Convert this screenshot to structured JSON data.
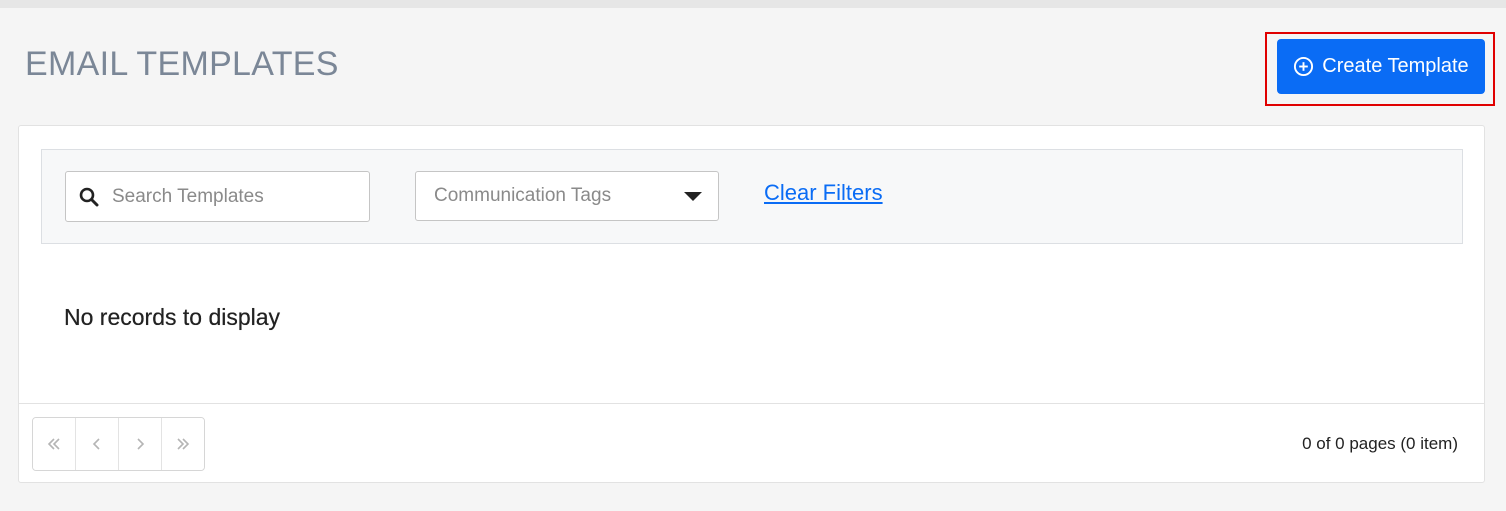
{
  "header": {
    "title": "EMAIL TEMPLATES",
    "create_button_label": "Create Template",
    "create_button_icon": "plus-circle-icon"
  },
  "filters": {
    "search_placeholder": "Search Templates",
    "search_value": "",
    "search_icon": "search-icon",
    "tags_placeholder": "Communication Tags",
    "clear_label": "Clear Filters"
  },
  "table": {
    "empty_message": "No records to display"
  },
  "pagination": {
    "first_icon": "double-chevron-left-icon",
    "prev_icon": "chevron-left-icon",
    "next_icon": "chevron-right-icon",
    "last_icon": "double-chevron-right-icon",
    "info": "0 of 0 pages (0 item)"
  },
  "colors": {
    "accent": "#0a6cf5",
    "title": "#7b8797",
    "highlight": "#e00000"
  }
}
